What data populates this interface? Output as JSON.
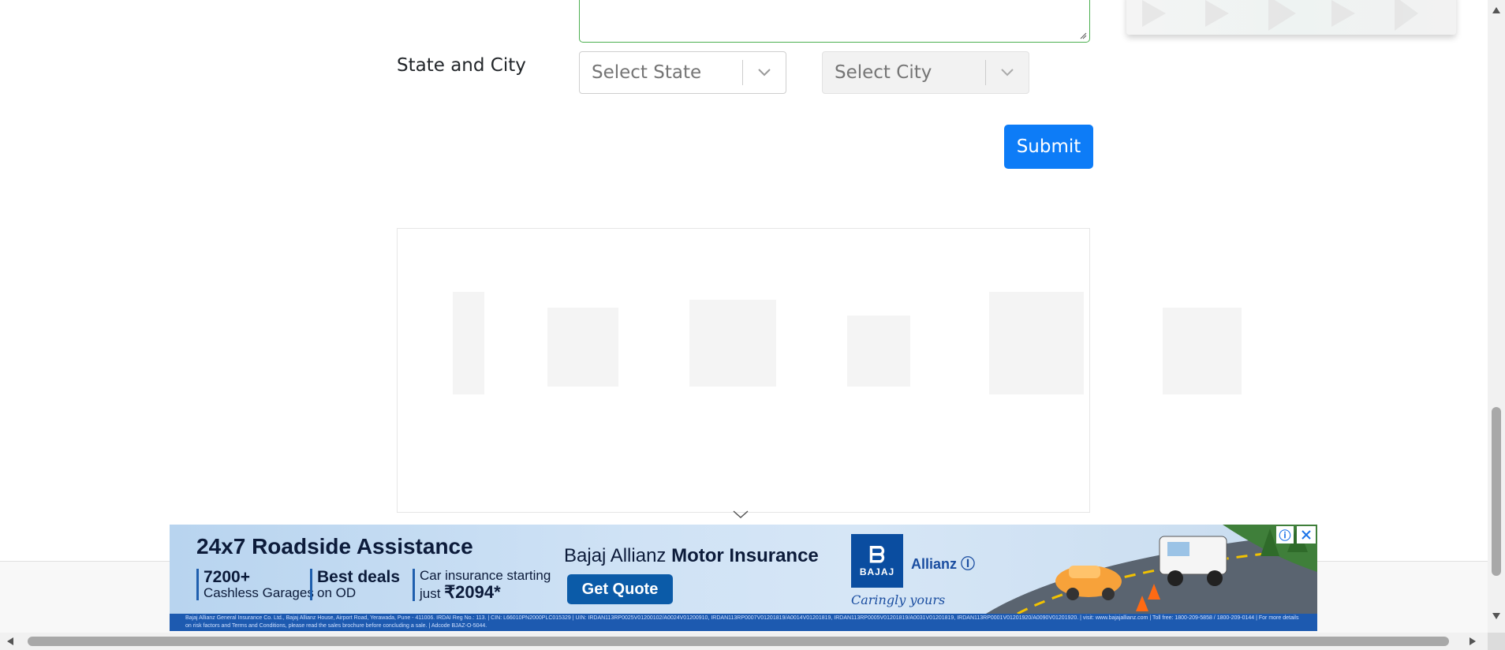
{
  "form": {
    "state_city_label": "State and City",
    "state_select": {
      "placeholder": "Select State"
    },
    "city_select": {
      "placeholder": "Select City"
    },
    "submit_label": "Submit"
  },
  "banner_ad": {
    "headline": "24x7 Roadside Assistance",
    "stat1_big": "7200+",
    "stat1_small": "Cashless Garages",
    "stat2_big": "Best deals",
    "stat2_small": "on OD",
    "stat3_line1": "Car insurance starting",
    "stat3_line2_prefix": "just ",
    "stat3_price": "₹2094*",
    "brand_prefix": "Bajaj Allianz ",
    "brand_bold": "Motor Insurance",
    "cta_label": "Get Quote",
    "logo_word": "BAJAJ",
    "allianz_label": "Allianz",
    "tagline": "Caringly yours",
    "disclaimer": "Bajaj Allianz General Insurance Co. Ltd., Bajaj Allianz House, Airport Road, Yerawada, Pune - 411006. IRDAI Reg No.: 113. | CIN: L66010PN2000PLC015329 | UIN: IRDAN113RP0025V01200102/A0024V01200910, IRDAN113RP0007V01201819/A0014V01201819, IRDAN113RP0005V01201819/A0031V01201819, IRDAN113RP0001V01201920/A0090V01201920. | visit: www.bajajallianz.com | Toll free: 1800-209-5858 / 1800-209-0144 | For more details on risk factors and Terms and Conditions, please read the sales brochure before concluding a sale. | Adcode BJAZ-O-5044."
  },
  "colors": {
    "submit_bg": "#0d7cf7",
    "textarea_border": "#4caf50",
    "ad_primary": "#0b5ba8"
  }
}
